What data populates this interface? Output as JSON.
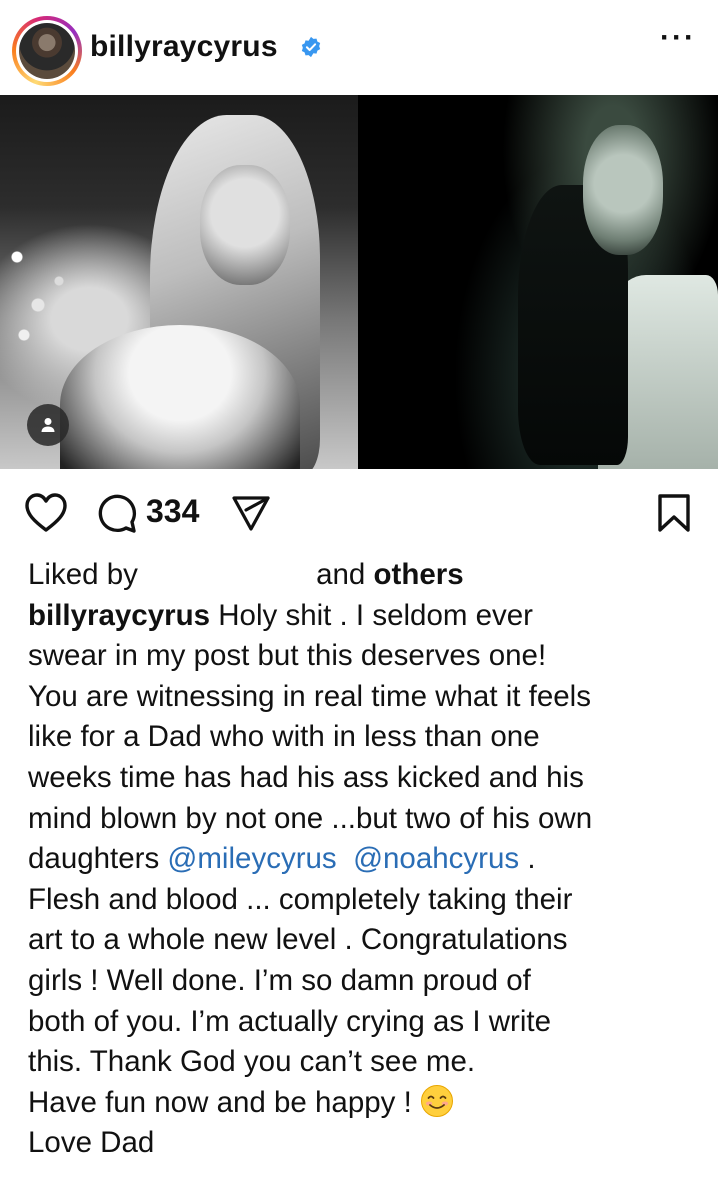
{
  "post": {
    "username": "billyraycyrus",
    "verified": true,
    "more_label": "···"
  },
  "actions": {
    "comment_count": "334"
  },
  "likes": {
    "prefix": "Liked by",
    "middle": "and",
    "suffix": "others"
  },
  "caption": {
    "username": "billyraycyrus",
    "lines": [
      " Holy shit . I seldom ever",
      "swear in my post but this deserves one!",
      "You are witnessing in real time what it feels",
      "like for a Dad who with in less than one",
      "weeks time has had his ass kicked and his",
      "mind blown by not one ...but two of his own"
    ],
    "daughters_prefix": "daughters ",
    "mention_1": "@mileycyrus",
    "mention_2": "@noahcyrus",
    "daughters_suffix": " .",
    "lines_after": [
      "Flesh and blood ... completely taking their",
      "art to a whole new level . Congratulations",
      "girls ! Well done.  I’m so damn proud of",
      "both of you. I’m actually crying as I write",
      "this. Thank God you can’t see me."
    ],
    "fun_line": "Have fun now and be happy !",
    "signoff": "Love Dad"
  },
  "icons": {
    "verified": "verified-badge-icon",
    "like": "heart-icon",
    "comment": "comment-icon",
    "share": "send-icon",
    "save": "bookmark-icon",
    "tagged": "user-tag-icon",
    "emoji": "smiling-face-emoji"
  },
  "colors": {
    "mention": "#2a6db5",
    "verified": "#3897f0",
    "text": "#111111"
  }
}
